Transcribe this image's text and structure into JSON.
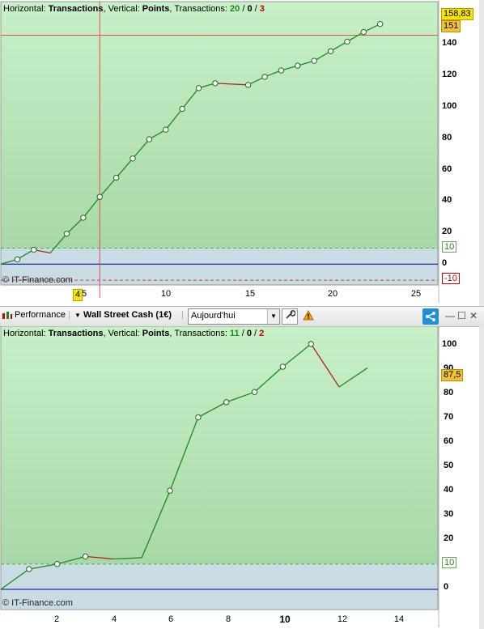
{
  "top": {
    "header": {
      "prefix_h": "Horizontal: ",
      "h": "Transactions",
      "prefix_v": ", Vertical: ",
      "v": "Points",
      "prefix_t": ", Transactions: ",
      "win": "20",
      "sep1": " / ",
      "even": "0",
      "sep2": " / ",
      "loss": "3"
    },
    "credit": "© IT-Finance.com",
    "badges": {
      "last": "158,83",
      "cursor": "151",
      "pos_ref": "10",
      "neg_ref": "-10",
      "x_cursor": "4"
    },
    "y_ticks": [
      "140",
      "120",
      "100",
      "80",
      "60",
      "40",
      "20",
      "0"
    ],
    "x_ticks": [
      "5",
      "10",
      "15",
      "20",
      "25"
    ]
  },
  "toolbar": {
    "performance": "Performance",
    "instrument": "Wall Street Cash (1€)",
    "period": "Aujourd'hui",
    "wrench_icon": "wrench-icon",
    "warning_icon": "warning-icon",
    "share_icon": "share-icon",
    "window_controls": [
      "minimize-icon",
      "maximize-icon",
      "close-icon"
    ]
  },
  "bottom": {
    "header": {
      "prefix_h": "Horizontal: ",
      "h": "Transactions",
      "prefix_v": ", Vertical: ",
      "v": "Points",
      "prefix_t": ", Transactions: ",
      "win": "11",
      "sep1": " / ",
      "even": "0",
      "sep2": " / ",
      "loss": "2"
    },
    "credit": "© IT-Finance.com",
    "badges": {
      "last": "87,5",
      "pos_ref": "10"
    },
    "y_ticks": [
      "100",
      "90",
      "80",
      "70",
      "60",
      "50",
      "40",
      "30",
      "20",
      "10",
      "0"
    ],
    "x_ticks": [
      "2",
      "4",
      "6",
      "8",
      "10",
      "12",
      "14"
    ]
  },
  "colors": {
    "green_line": "#1a8c1a",
    "red_line": "#b22222",
    "plot_bg_top": "#c8f0c8",
    "plot_bg_bottom": "#a8d8a8",
    "neg_zone": "#c9dbe3",
    "zero_line": "#0000a0",
    "cursor": "#e05050"
  },
  "chart_data": [
    {
      "type": "line",
      "xlabel": "Transactions",
      "ylabel": "Points",
      "xlim": [
        0,
        26.5
      ],
      "ylim": [
        -13,
        164
      ],
      "ref_lines": [
        10,
        -10,
        0
      ],
      "cursor": {
        "x": 6,
        "y": 143
      },
      "points": [
        [
          0,
          0
        ],
        [
          1,
          3
        ],
        [
          2,
          9
        ],
        [
          3,
          7
        ],
        [
          4,
          19
        ],
        [
          5,
          29
        ],
        [
          6,
          42
        ],
        [
          7,
          54
        ],
        [
          8,
          66
        ],
        [
          9,
          78
        ],
        [
          10,
          84
        ],
        [
          11,
          97
        ],
        [
          12,
          110
        ],
        [
          13,
          113
        ],
        [
          15,
          112
        ],
        [
          16,
          117
        ],
        [
          17,
          121
        ],
        [
          18,
          124
        ],
        [
          19,
          127
        ],
        [
          20,
          133
        ],
        [
          21,
          139
        ],
        [
          22,
          145
        ],
        [
          23,
          150
        ]
      ],
      "markers": [
        1,
        2,
        4,
        5,
        6,
        7,
        8,
        9,
        10,
        11,
        12,
        13,
        15,
        16,
        17,
        18,
        19,
        20,
        21,
        22,
        23
      ],
      "losing_segments": [
        [
          2,
          3
        ],
        [
          13,
          15
        ]
      ],
      "last_value": 158.83
    },
    {
      "type": "line",
      "xlabel": "Transactions",
      "ylabel": "Points",
      "xlim": [
        0,
        15.5
      ],
      "ylim": [
        -8,
        104
      ],
      "ref_lines": [
        10,
        0
      ],
      "points": [
        [
          0,
          0
        ],
        [
          1,
          8
        ],
        [
          2,
          10
        ],
        [
          3,
          13
        ],
        [
          4,
          12
        ],
        [
          5,
          12.5
        ],
        [
          6,
          39
        ],
        [
          7,
          68
        ],
        [
          8,
          74
        ],
        [
          9,
          78
        ],
        [
          10,
          88
        ],
        [
          11,
          97
        ],
        [
          12,
          80
        ],
        [
          13,
          87.5
        ]
      ],
      "markers": [
        1,
        2,
        3,
        6,
        7,
        8,
        9,
        10,
        11
      ],
      "losing_segments": [
        [
          3,
          4
        ],
        [
          11,
          12
        ]
      ],
      "last_value": 87.5
    }
  ]
}
